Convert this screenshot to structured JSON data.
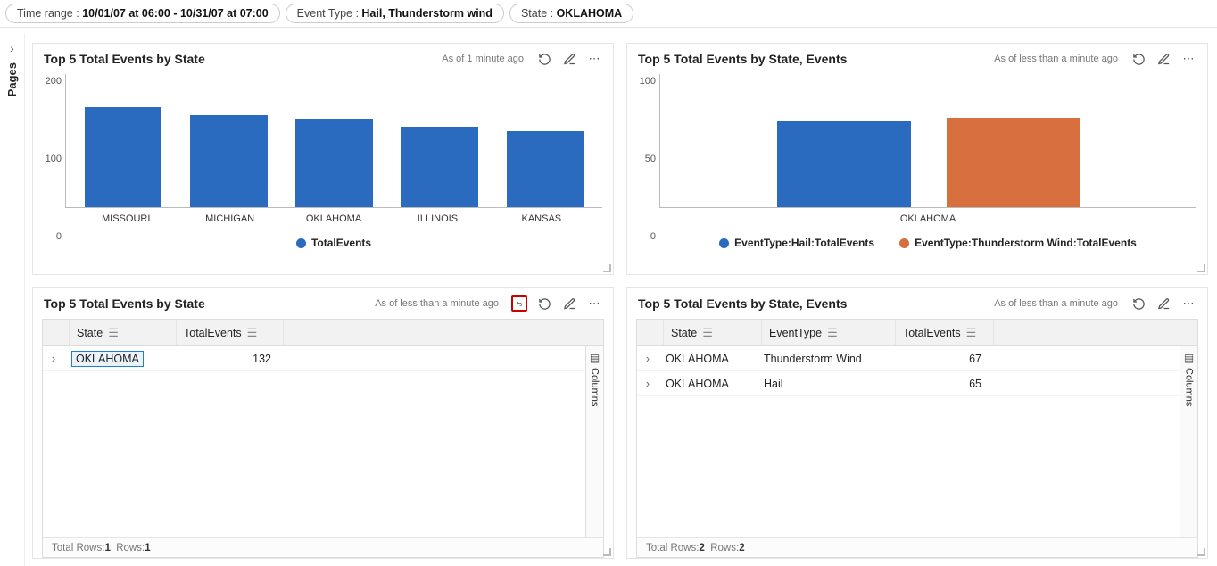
{
  "filters": {
    "time_label": "Time range : ",
    "time_value": "10/01/07 at 06:00 - 10/31/07 at 07:00",
    "event_label": "Event Type : ",
    "event_value": "Hail, Thunderstorm wind",
    "state_label": "State : ",
    "state_value": "OKLAHOMA"
  },
  "sidebar": {
    "pages": "Pages"
  },
  "panels": {
    "p1": {
      "title": "Top 5 Total Events by State",
      "asof": "As of 1 minute ago",
      "legend": "TotalEvents"
    },
    "p2": {
      "title": "Top 5 Total Events by State, Events",
      "asof": "As of less than a minute ago",
      "legend1": "EventType:Hail:TotalEvents",
      "legend2": "EventType:Thunderstorm Wind:TotalEvents"
    },
    "p3": {
      "title": "Top 5 Total Events by State",
      "asof": "As of less than a minute ago",
      "col_state": "State",
      "col_total": "TotalEvents",
      "row_state": "OKLAHOMA",
      "row_total": "132",
      "footer": "Total Rows: ",
      "footer_n1": "1",
      "footer_mid": "  Rows: ",
      "footer_n2": "1",
      "columns_label": "Columns"
    },
    "p4": {
      "title": "Top 5 Total Events by State, Events",
      "asof": "As of less than a minute ago",
      "col_state": "State",
      "col_event": "EventType",
      "col_total": "TotalEvents",
      "r1_state": "OKLAHOMA",
      "r1_event": "Thunderstorm Wind",
      "r1_total": "67",
      "r2_state": "OKLAHOMA",
      "r2_event": "Hail",
      "r2_total": "65",
      "footer": "Total Rows: ",
      "footer_n1": "2",
      "footer_mid": "  Rows: ",
      "footer_n2": "2",
      "columns_label": "Columns"
    }
  },
  "chart_data": [
    {
      "type": "bar",
      "title": "Top 5 Total Events by State",
      "categories": [
        "MISSOURI",
        "MICHIGAN",
        "OKLAHOMA",
        "ILLINOIS",
        "KANSAS"
      ],
      "values": [
        150,
        138,
        132,
        120,
        113
      ],
      "ylim": [
        0,
        200
      ],
      "yticks": [
        0,
        100,
        200
      ],
      "legend": [
        "TotalEvents"
      ]
    },
    {
      "type": "bar",
      "title": "Top 5 Total Events by State, Events",
      "categories": [
        "OKLAHOMA"
      ],
      "series": [
        {
          "name": "EventType:Hail:TotalEvents",
          "values": [
            65
          ],
          "color": "#2a6abf"
        },
        {
          "name": "EventType:Thunderstorm Wind:TotalEvents",
          "values": [
            67
          ],
          "color": "#d86f3e"
        }
      ],
      "ylim": [
        0,
        100
      ],
      "yticks": [
        0,
        50,
        100
      ]
    }
  ],
  "yticks": {
    "c1_t0": "0",
    "c1_t1": "100",
    "c1_t2": "200",
    "c2_t0": "0",
    "c2_t1": "50",
    "c2_t2": "100"
  },
  "xlabs": {
    "c1_0": "MISSOURI",
    "c1_1": "MICHIGAN",
    "c1_2": "OKLAHOMA",
    "c1_3": "ILLINOIS",
    "c1_4": "KANSAS",
    "c2_0": "OKLAHOMA"
  }
}
